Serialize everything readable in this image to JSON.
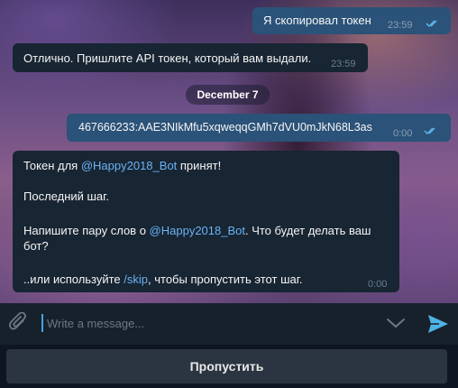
{
  "messages": [
    {
      "direction": "out",
      "text": "Я скопировал токен",
      "time": "23:59"
    },
    {
      "direction": "in",
      "text": "Отлично. Пришлите API токен, который вам выдали.",
      "time": "23:59"
    },
    {
      "direction": "out",
      "text": "467666233:AAE3NIkMfu5xqweqqGMh7dVU0mJkN68L3as",
      "time": "0:00"
    }
  ],
  "date_separator": "December 7",
  "bot_message": {
    "line1_prefix": "Токен для ",
    "line1_link": "@Happy2018_Bot",
    "line1_suffix": " принят!",
    "line2": "Последний шаг.",
    "line3_prefix": "Напишите пару слов о ",
    "line3_link": "@Happy2018_Bot",
    "line3_suffix": ". Что будет делать ваш",
    "line3_cont": "бот?",
    "line4_prefix": "..или используйте ",
    "line4_link": "/skip",
    "line4_suffix": ", чтобы пропустить этот шаг.",
    "time": "0:00"
  },
  "composer": {
    "placeholder": "Write a message..."
  },
  "skip_button": "Пропустить",
  "colors": {
    "outgoing_bubble": "#2b5278",
    "incoming_bubble": "#182533",
    "link": "#6ab3f3",
    "send": "#4fb2e6"
  }
}
